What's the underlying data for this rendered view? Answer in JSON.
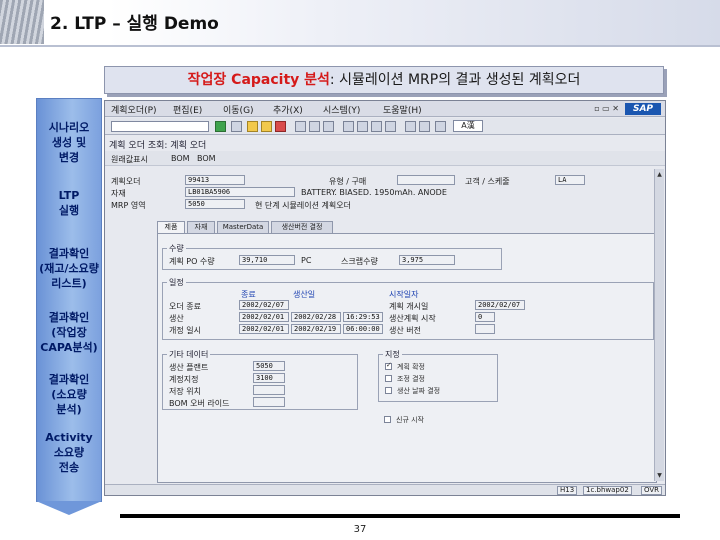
{
  "slide": {
    "title": "2. LTP – 실행 Demo",
    "subtitle_accent": "작업장 Capacity 분석",
    "subtitle_rest": ": 시뮬레이션 MRP의 결과 생성된 계획오더",
    "page_number": "37"
  },
  "steps": [
    "시나리오\n생성 및\n변경",
    "LTP\n실행",
    "결과확인\n(재고/소요량\n리스트)",
    "결과확인\n(작업장\nCAPA분석)",
    "결과확인\n(소요량\n분석)",
    "Activity\n소요량\n전송"
  ],
  "sap": {
    "logo": "SAP",
    "menu": [
      "계획오더(P)",
      "편집(E)",
      "이동(G)",
      "추가(X)",
      "시스템(Y)",
      "도움말(H)"
    ],
    "keyboard": "A漢",
    "app_title": "계획 오더 조회: 계획 오더",
    "app_toolbar": [
      "원래값표시",
      "BOM",
      "BOM"
    ],
    "header_fields": {
      "order_label": "계획오더",
      "order_value": "99413",
      "material_label": "자재",
      "material_value": "LB01BA5906",
      "mrp_area_label": "MRP 영역",
      "mrp_area_value": "5050",
      "type_label": "유형 / 구매",
      "type_value": "",
      "control_label": "고객 / 스케줄",
      "control_value": "LA",
      "material_desc": "BATTERY. BIASED. 1950mAh. ANODE",
      "note": "현 단계 시뮬레이션 계획오더"
    },
    "tabs": [
      "제품",
      "자재",
      "MasterData",
      "생산버전 결정"
    ],
    "qty_group": {
      "title": "수량",
      "qty_label": "계획 PO 수량",
      "qty_value": "39,710",
      "unit": "PC",
      "scrap_label": "스크랩수량",
      "scrap_value": "3,975"
    },
    "dates_group": {
      "title": "일정",
      "col_end": "종료",
      "col_time": "생산일",
      "col_start": "시작일자",
      "rows": [
        {
          "label": "오더 종료",
          "end": "2002/02/07",
          "time": "2002/02/07",
          "start_label": "계획 개시일",
          "start": "2002/02/07"
        },
        {
          "label": "생산",
          "end": "2002/02/01",
          "time": "2002/02/28",
          "extra": "16:29:53",
          "start_label": "생산계획 시작",
          "start": "0"
        },
        {
          "label": "개정 일시",
          "end": "2002/02/01",
          "time": "2002/02/19",
          "extra": "06:00:00",
          "start_label": "생산 버전",
          "start": ""
        }
      ]
    },
    "other_group": {
      "title": "기타 데이터",
      "rows": [
        {
          "label": "생산 플랜트",
          "value": "5050"
        },
        {
          "label": "계정지정",
          "value": "3100"
        },
        {
          "label": "저장 위치",
          "value": ""
        },
        {
          "label": "BOM 오버 라이드",
          "value": ""
        }
      ]
    },
    "flags_group": {
      "title": "지정",
      "items": [
        {
          "label": "계획 확정",
          "checked": true
        },
        {
          "label": "조정 결정",
          "checked": false
        },
        {
          "label": "생산 날짜 결정",
          "checked": false
        },
        {
          "label": "신규 시작",
          "checked": false
        }
      ]
    },
    "status": {
      "system": "H13",
      "client": "1c.bhwap02",
      "mode": "OVR"
    }
  }
}
